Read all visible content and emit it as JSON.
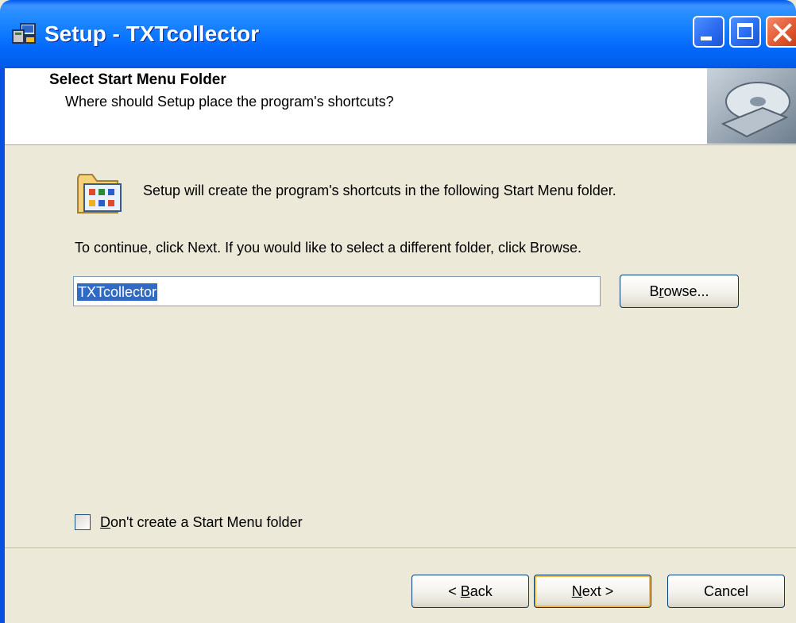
{
  "window": {
    "title": "Setup - TXTcollector"
  },
  "header": {
    "title": "Select Start Menu Folder",
    "subtitle": "Where should Setup place the program's shortcuts?"
  },
  "body": {
    "intro": "Setup will create the program's shortcuts in the following Start Menu folder.",
    "instruction": "To continue, click Next. If you would like to select a different folder, click Browse.",
    "folder_value": "TXTcollector",
    "browse": {
      "pre": "B",
      "ul": "r",
      "post": "owse..."
    },
    "checkbox": {
      "ul": "D",
      "post": "on't create a Start Menu folder",
      "checked": false
    }
  },
  "footer": {
    "back": {
      "pre": "< ",
      "ul": "B",
      "post": "ack"
    },
    "next": {
      "ul": "N",
      "post": "ext >"
    },
    "cancel": "Cancel"
  },
  "colors": {
    "titlebar": "#0058ee",
    "dialog_bg": "#ece9d8",
    "selection": "#316ac5",
    "close_button": "#e15b33"
  }
}
